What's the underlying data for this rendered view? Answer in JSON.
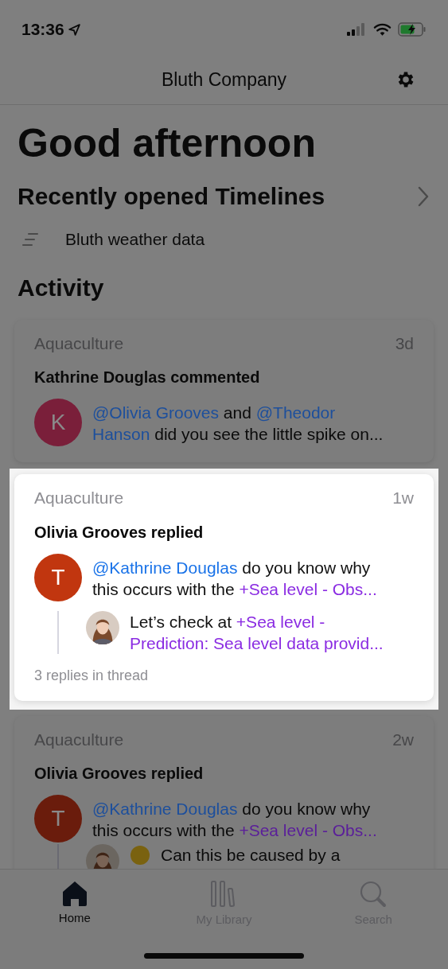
{
  "status_bar": {
    "time": "13:36"
  },
  "header": {
    "title": "Bluth Company"
  },
  "greeting": "Good afternoon",
  "recent": {
    "heading": "Recently opened Timelines",
    "items": [
      {
        "label": "Bluth weather data"
      }
    ]
  },
  "activity": {
    "heading": "Activity",
    "cards": [
      {
        "highlighted": false,
        "project": "Aquaculture",
        "time": "3d",
        "headline": "Kathrine Douglas commented",
        "avatar": {
          "kind": "initial",
          "letter": "K",
          "color": "#7a1f3a"
        },
        "message": [
          {
            "kind": "mention",
            "text": "@Olivia Grooves"
          },
          {
            "kind": "plain",
            "text": " and "
          },
          {
            "kind": "mention",
            "text": "@Theodor Hanson"
          },
          {
            "kind": "plain",
            "text": " did you see the little spike on..."
          }
        ]
      },
      {
        "highlighted": true,
        "project": "Aquaculture",
        "time": "1w",
        "headline": "Olivia Grooves replied",
        "avatar": {
          "kind": "initial",
          "letter": "T",
          "color": "#c1360f"
        },
        "message": [
          {
            "kind": "mention",
            "text": "@Kathrine Douglas"
          },
          {
            "kind": "plain",
            "text": " do you know why this occurs with the "
          },
          {
            "kind": "link",
            "text": "+Sea level - Obs..."
          }
        ],
        "reply": {
          "message": [
            {
              "kind": "plain",
              "text": "Let’s check at "
            },
            {
              "kind": "link",
              "text": "+Sea level - Prediction: Sea level data provid..."
            }
          ]
        },
        "replies": "3 replies in thread"
      },
      {
        "highlighted": false,
        "project": "Aquaculture",
        "time": "2w",
        "headline": "Olivia Grooves replied",
        "avatar": {
          "kind": "initial",
          "letter": "T",
          "color": "#6a1c0c"
        },
        "message": [
          {
            "kind": "mention",
            "text": "@Kathrine Douglas"
          },
          {
            "kind": "plain",
            "text": " do you know why this occurs with the "
          },
          {
            "kind": "link",
            "text": "+Sea level - Obs..."
          }
        ],
        "reply": {
          "emoji": true,
          "message": [
            {
              "kind": "plain",
              "text": "Can this be caused by a"
            }
          ]
        }
      }
    ]
  },
  "tabs": [
    {
      "label": "Home",
      "kind": "home",
      "selected": true
    },
    {
      "label": "My Library",
      "kind": "library",
      "selected": false
    },
    {
      "label": "Search",
      "kind": "search",
      "selected": false
    }
  ]
}
